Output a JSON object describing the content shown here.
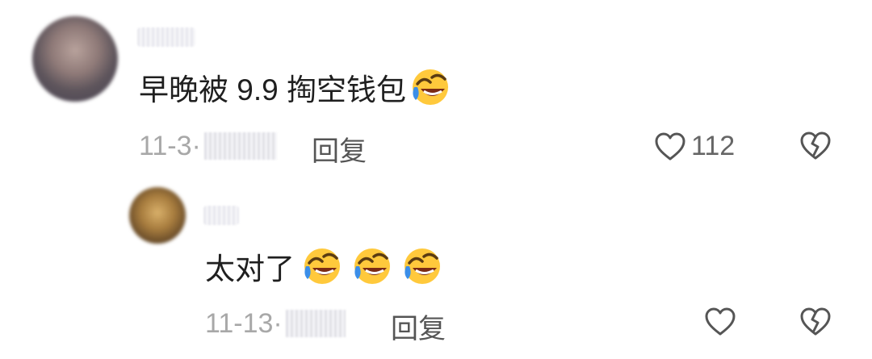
{
  "comments": [
    {
      "text": "早晚被 9.9 掏空钱包",
      "emojis": [
        "laughing-crying-emoji"
      ],
      "date": "11-3·",
      "reply_label": "回复",
      "like_count": "112"
    },
    {
      "text": "太对了",
      "emojis": [
        "laughing-crying-emoji",
        "laughing-crying-emoji",
        "laughing-crying-emoji"
      ],
      "date": "11-13·",
      "reply_label": "回复",
      "like_count": ""
    }
  ],
  "colors": {
    "text": "#1f1f1f",
    "meta": "#a8a8a8",
    "icon": "#555555",
    "emoji_face": "#ffc93c",
    "emoji_tear": "#3b8ee8"
  }
}
